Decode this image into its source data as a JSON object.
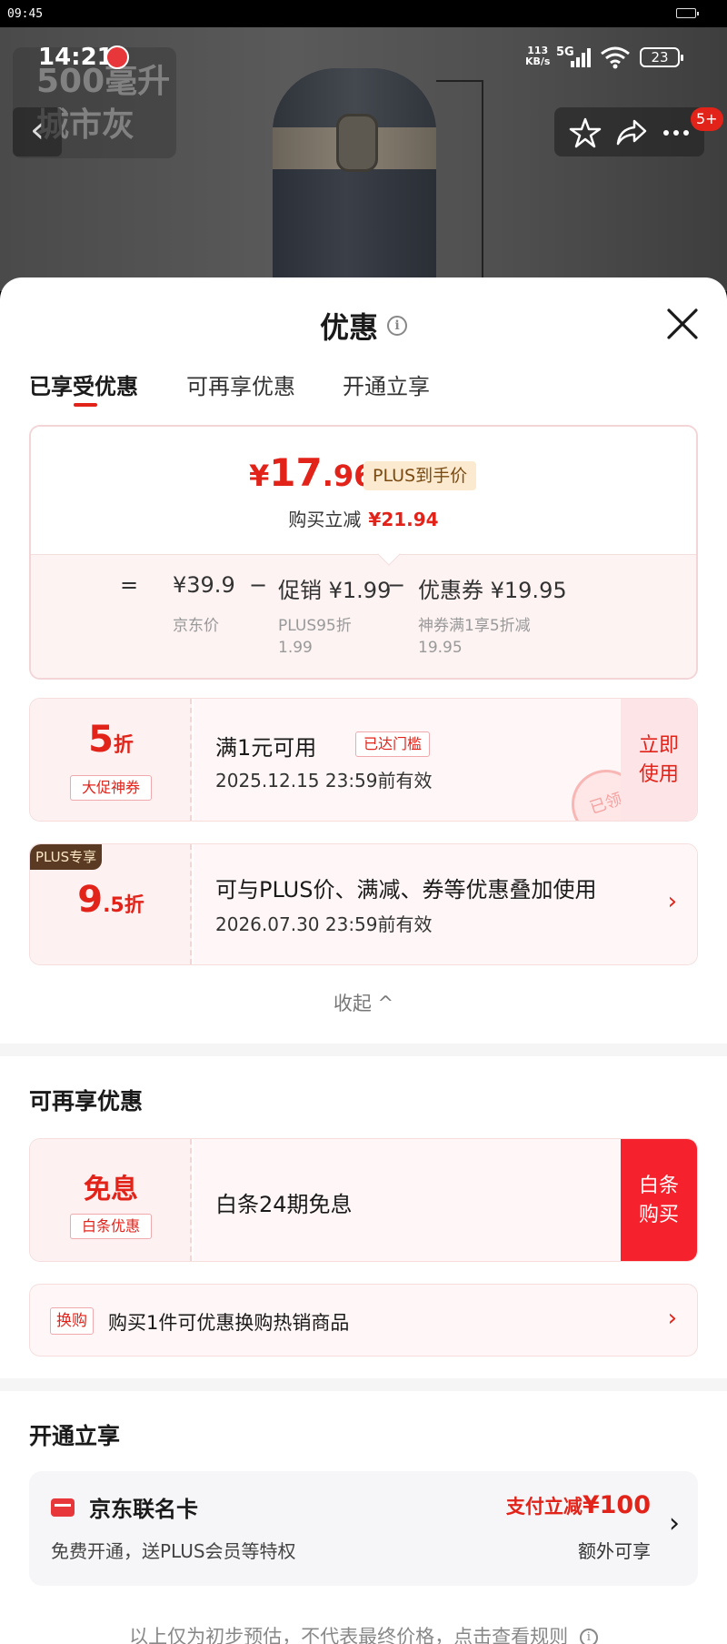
{
  "outer_status": {
    "time": "09:45"
  },
  "product": {
    "variant_line1": "500毫升",
    "variant_line2": "城市灰"
  },
  "status": {
    "time": "14:21",
    "net_speed": "113",
    "net_unit": "KB/s",
    "net_type": "5G",
    "battery": "23"
  },
  "nav": {
    "badge": "5+"
  },
  "sheet": {
    "title": "优惠",
    "tabs": [
      "已享受优惠",
      "可再享优惠",
      "开通立享"
    ],
    "summary": {
      "currency": "¥",
      "price_int": "17",
      "price_dec": ".96",
      "price_tag": "PLUS到手价",
      "reduce_label": "购买立减",
      "reduce_value": "¥21.94",
      "eq": "=",
      "minus": "−",
      "list_price": "¥39.9",
      "list_label": "京东价",
      "promo_price": "促销 ¥1.99",
      "promo_label": "PLUS95折",
      "promo_sub": "1.99",
      "coupon_price": "优惠券 ¥19.95",
      "coupon_label": "神券满1享5折减",
      "coupon_sub": "19.95"
    },
    "coupons": [
      {
        "discount": "5",
        "unit": "折",
        "tag": "大促神券",
        "title": "满1元可用",
        "threshold": "已达门槛",
        "valid": "2025.12.15 23:59前有效",
        "action_1": "立即",
        "action_2": "使用",
        "stamp": "已领"
      },
      {
        "badge": "PLUS专享",
        "discount": "9",
        "unit": ".5折",
        "title": "可与PLUS价、满减、券等优惠叠加使用",
        "valid": "2026.07.30 23:59前有效"
      }
    ],
    "collapse": "收起 ^",
    "section2_title": "可再享优惠",
    "baitiao": {
      "main": "免息",
      "tag": "白条优惠",
      "title": "白条24期免息",
      "action_1": "白条",
      "action_2": "购买"
    },
    "exchange": {
      "tag": "换购",
      "text": "购买1件可优惠换购热销商品"
    },
    "section3_title": "开通立享",
    "card": {
      "name": "京东联名卡",
      "desc": "免费开通，送PLUS会员等特权",
      "promo_prefix": "支付立减",
      "promo_amount": "¥100",
      "extra": "额外可享"
    },
    "footer": "以上仅为初步预估，不代表最终价格，点击查看规则"
  }
}
